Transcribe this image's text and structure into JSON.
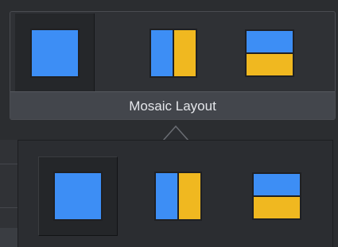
{
  "toolbar": {
    "caption": "Mosaic Layout",
    "options": [
      {
        "name": "single-view",
        "icon": "single-pane-layout-icon",
        "selected": true
      },
      {
        "name": "side-by-side",
        "icon": "vertical-split-layout-icon",
        "selected": false
      },
      {
        "name": "stacked",
        "icon": "horizontal-split-layout-icon",
        "selected": false
      }
    ]
  },
  "popup": {
    "options": [
      {
        "name": "single-view",
        "icon": "single-pane-layout-icon",
        "selected": true
      },
      {
        "name": "side-by-side",
        "icon": "vertical-split-layout-icon",
        "selected": false
      },
      {
        "name": "stacked",
        "icon": "horizontal-split-layout-icon",
        "selected": false
      }
    ]
  },
  "colors": {
    "pane_blue": "#3d8ef5",
    "pane_yellow": "#f0b820",
    "icon_border": "#1f2023",
    "caption_bg": "#43464c",
    "caption_text": "#e4e6ea"
  }
}
